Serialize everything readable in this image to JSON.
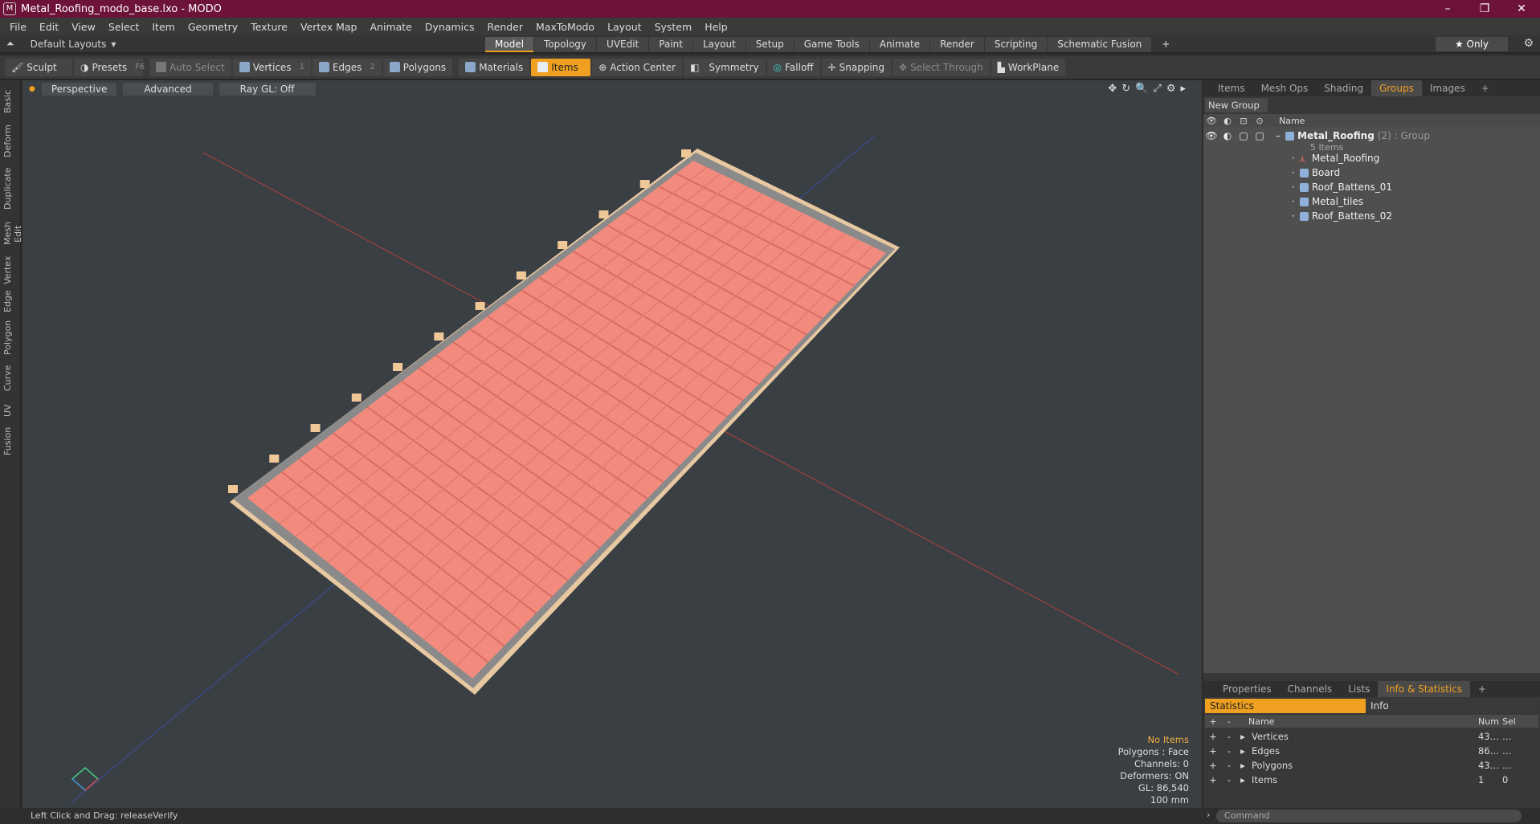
{
  "window": {
    "title": "Metal_Roofing_modo_base.lxo - MODO",
    "app_icon": "M"
  },
  "menu": [
    "File",
    "Edit",
    "View",
    "Select",
    "Item",
    "Geometry",
    "Texture",
    "Vertex Map",
    "Animate",
    "Dynamics",
    "Render",
    "MaxToModo",
    "Layout",
    "System",
    "Help"
  ],
  "layout": {
    "name": "Default Layouts"
  },
  "top_tabs": [
    {
      "label": "Model",
      "active": true
    },
    {
      "label": "Topology"
    },
    {
      "label": "UVEdit"
    },
    {
      "label": "Paint"
    },
    {
      "label": "Layout"
    },
    {
      "label": "Setup"
    },
    {
      "label": "Game Tools"
    },
    {
      "label": "Animate"
    },
    {
      "label": "Render"
    },
    {
      "label": "Scripting"
    },
    {
      "label": "Schematic Fusion"
    },
    {
      "label": "+"
    }
  ],
  "only_label": "★  Only",
  "toolbar": {
    "sculpt": "Sculpt",
    "presets": "Presets",
    "presets_key": "F6",
    "auto_select": "Auto Select",
    "vertices": "Vertices",
    "vertices_key": "1",
    "edges": "Edges",
    "edges_key": "2",
    "polygons": "Polygons",
    "materials": "Materials",
    "items": "Items",
    "action_center": "Action Center",
    "symmetry": "Symmetry",
    "falloff": "Falloff",
    "snapping": "Snapping",
    "select_through": "Select Through",
    "workplane": "WorkPlane"
  },
  "left_tabs": [
    "Basic",
    "Deform",
    "Duplicate",
    "Mesh Edit",
    "Vertex",
    "Edge",
    "Polygon",
    "Curve",
    "UV",
    "Fusion"
  ],
  "viewport": {
    "view": "Perspective",
    "shading": "Advanced",
    "raygl": "Ray GL: Off",
    "info": {
      "items": "No Items",
      "polygons": "Polygons : Face",
      "channels": "Channels: 0",
      "deformers": "Deformers: ON",
      "gl": "GL: 86,540",
      "scale": "100 mm"
    }
  },
  "status": "Left Click and Drag:  releaseVerify",
  "right_tabs": [
    {
      "label": "Items"
    },
    {
      "label": "Mesh Ops"
    },
    {
      "label": "Shading"
    },
    {
      "label": "Groups",
      "active": true
    },
    {
      "label": "Images"
    },
    {
      "label": "+"
    }
  ],
  "groups": {
    "new_group": "New Group",
    "name_col": "Name",
    "root": {
      "name": "Metal_Roofing",
      "suffix": "(2) : Group",
      "count": "5 Items"
    },
    "children": [
      "Metal_Roofing",
      "Board",
      "Roof_Battens_01",
      "Metal_tiles",
      "Roof_Battens_02"
    ]
  },
  "bottom_tabs": [
    {
      "label": "Properties"
    },
    {
      "label": "Channels"
    },
    {
      "label": "Lists"
    },
    {
      "label": "Info & Statistics",
      "active": true
    },
    {
      "label": "+"
    }
  ],
  "stats": {
    "tab_statistics": "Statistics",
    "tab_info": "Info",
    "col_name": "Name",
    "col_num": "Num",
    "col_sel": "Sel",
    "rows": [
      {
        "name": "Vertices",
        "num": "43…",
        "sel": "…"
      },
      {
        "name": "Edges",
        "num": "86…",
        "sel": "…"
      },
      {
        "name": "Polygons",
        "num": "43…",
        "sel": "…"
      },
      {
        "name": "Items",
        "num": "1",
        "sel": "0"
      }
    ]
  },
  "command_placeholder": "Command",
  "colors": {
    "accent": "#f0a020",
    "titlebar": "#6d1238",
    "tile": "#f08878"
  }
}
